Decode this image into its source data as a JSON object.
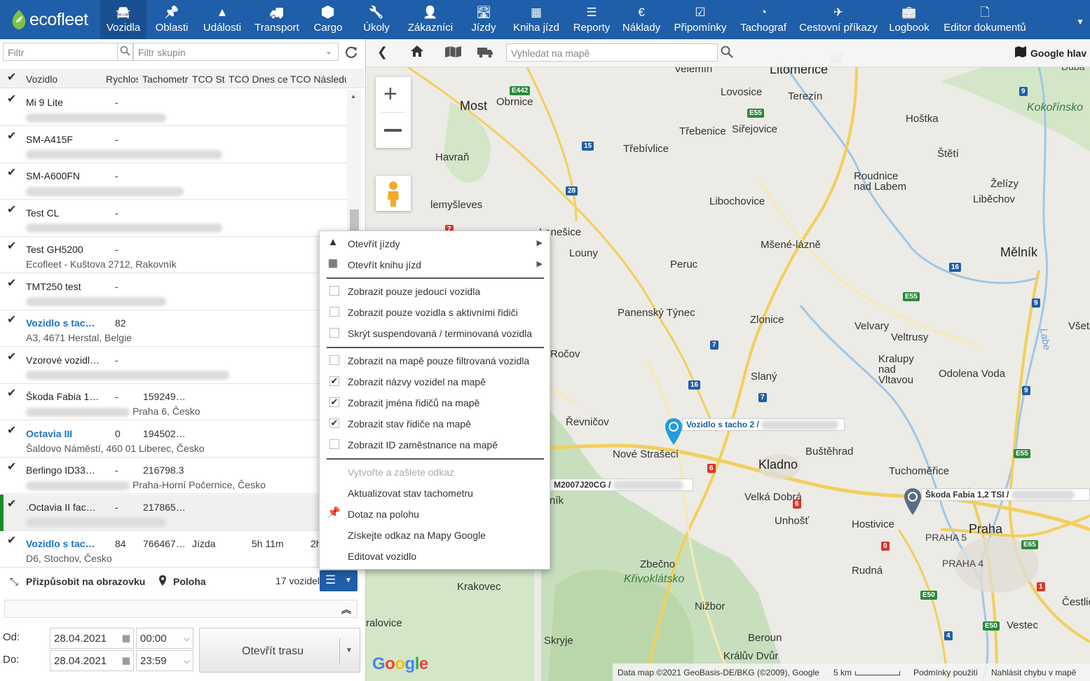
{
  "app": {
    "logo_text": "ecofleet"
  },
  "nav": [
    {
      "label": "Vozidla",
      "icon": "car-icon"
    },
    {
      "label": "Oblasti",
      "icon": "pin-icon"
    },
    {
      "label": "Události",
      "icon": "warning-icon"
    },
    {
      "label": "Transport",
      "icon": "truck-icon"
    },
    {
      "label": "Cargo",
      "icon": "box-icon"
    },
    {
      "label": "Úkoly",
      "icon": "wrench-icon"
    },
    {
      "label": "Zákazníci",
      "icon": "person-icon"
    },
    {
      "label": "Jízdy",
      "icon": "road-icon"
    },
    {
      "label": "Kniha jízd",
      "icon": "calendar-icon"
    },
    {
      "label": "Reporty",
      "icon": "document-icon"
    },
    {
      "label": "Náklady",
      "icon": "euro-icon"
    },
    {
      "label": "Připomínky",
      "icon": "calendar-check-icon"
    },
    {
      "label": "Tachograf",
      "icon": "gauge-icon"
    },
    {
      "label": "Cestovní příkazy",
      "icon": "plane-icon"
    },
    {
      "label": "Logbook",
      "icon": "briefcase-icon"
    },
    {
      "label": "Editor dokumentů",
      "icon": "file-icon"
    }
  ],
  "left": {
    "filter_placeholder": "Filtr",
    "group_filter_placeholder": "Filtr skupin",
    "columns": [
      "Vozidlo",
      "Rychlost",
      "Tachometr",
      "TCO St",
      "TCO Dnes ce",
      "TCO Následu"
    ],
    "vehicles": [
      {
        "name": "Mi 9 Lite",
        "speed": "-",
        "tach": "",
        "status": "",
        "d1": "",
        "d2": "",
        "addr": "",
        "link": false
      },
      {
        "name": "SM-A415F",
        "speed": "-",
        "tach": "",
        "status": "",
        "d1": "",
        "d2": "",
        "addr": "",
        "link": false
      },
      {
        "name": "SM-A600FN",
        "speed": "-",
        "tach": "",
        "status": "",
        "d1": "",
        "d2": "",
        "addr": "",
        "link": false
      },
      {
        "name": "Test CL",
        "speed": "-",
        "tach": "",
        "status": "",
        "d1": "",
        "d2": "",
        "addr": "",
        "link": false
      },
      {
        "name": "Test GH5200",
        "speed": "-",
        "tach": "",
        "status": "",
        "d1": "",
        "d2": "",
        "addr": "Ecofleet - Kuštova 2712, Rakovník",
        "link": false
      },
      {
        "name": "TMT250 test",
        "speed": "-",
        "tach": "",
        "status": "",
        "d1": "",
        "d2": "",
        "addr": "",
        "link": false
      },
      {
        "name": "Vozidlo s tac…",
        "speed": "82",
        "tach": "",
        "status": "",
        "d1": "",
        "d2": "",
        "addr": "A3, 4671 Herstal, Belgie",
        "link": true
      },
      {
        "name": "Vzorové vozidl…",
        "speed": "-",
        "tach": "",
        "status": "",
        "d1": "",
        "d2": "",
        "addr": "",
        "link": false
      },
      {
        "name": "Škoda Fabia 1…",
        "speed": "-",
        "tach": "159249…",
        "status": "",
        "d1": "",
        "d2": "",
        "addr": "Praha 6, Česko",
        "link": false
      },
      {
        "name": "Octavia III",
        "speed": "0",
        "tach": "194502…",
        "status": "",
        "d1": "",
        "d2": "",
        "addr": "Šaldovo Náměstí, 460 01 Liberec, Česko",
        "link": true
      },
      {
        "name": "Berlingo ID33…",
        "speed": "-",
        "tach": "216798.3",
        "status": "",
        "d1": "",
        "d2": "",
        "addr": "Praha-Horní Počernice, Česko",
        "link": false
      },
      {
        "name": ".Octavia II fac…",
        "speed": "-",
        "tach": "217865…",
        "status": "",
        "d1": "",
        "d2": "",
        "addr": "",
        "link": false
      },
      {
        "name": "Vozidlo s tac…",
        "speed": "84",
        "tach": "766467…",
        "status": "Jízda",
        "d1": "5h 11m",
        "d2": "2h",
        "addr": "D6, Stochov, Česko",
        "link": true
      }
    ],
    "fit_label": "Přizpůsobit na obrazovku",
    "position_label": "Poloha",
    "count_label": "17 vozidel",
    "from_label": "Od:",
    "to_label": "Do:",
    "from_date": "28.04.2021",
    "from_time": "00:00",
    "to_date": "28.04.2021",
    "to_time": "23:59",
    "open_route": "Otevřít trasu"
  },
  "map": {
    "search_placeholder": "Vyhledat na mapě",
    "google_label": "Google hlav",
    "attribution": "Data map ©2021 GeoBasis-DE/BKG (©2009), Google",
    "scale": "5 km",
    "terms": "Podmínky použití",
    "report": "Nahlásit chybu v mapě",
    "google_logo": "Google",
    "vehicle_labels": [
      "Vozidlo s tacho 2 /",
      "M2007J20CG /",
      "Škoda Fabia 1,2 TSI /"
    ],
    "places": [
      {
        "t": "Velemín"
      },
      {
        "t": "Litoměřice"
      },
      {
        "t": "Dubá"
      },
      {
        "t": "Lovosice"
      },
      {
        "t": "Terezín"
      },
      {
        "t": "Most"
      },
      {
        "t": "Obrnice"
      },
      {
        "t": "Kokořínsko"
      },
      {
        "t": "Hoštka"
      },
      {
        "t": "Třebenice"
      },
      {
        "t": "Siřejovice"
      },
      {
        "t": "Třebívlice"
      },
      {
        "t": "Štětí"
      },
      {
        "t": "Havraň"
      },
      {
        "t": "Roudnice nad Labem"
      },
      {
        "t": "Želízy"
      },
      {
        "t": "Liběchov"
      },
      {
        "t": "Libochovice"
      },
      {
        "t": "lemyšleves"
      },
      {
        "t": "Lenešice"
      },
      {
        "t": "Mšené-lázně"
      },
      {
        "t": "Louny"
      },
      {
        "t": "Peruc"
      },
      {
        "t": "Mělník"
      },
      {
        "t": "Panenský Týnec"
      },
      {
        "t": "Zlonice"
      },
      {
        "t": "Velvary"
      },
      {
        "t": "Veltrusy"
      },
      {
        "t": "Všetaty"
      },
      {
        "t": "Ročov"
      },
      {
        "t": "Kralupy nad Vltavou"
      },
      {
        "t": "Odolena Voda"
      },
      {
        "t": "Slaný"
      },
      {
        "t": "Řevničov"
      },
      {
        "t": "Nové Strašecí"
      },
      {
        "t": "Buštěhrad"
      },
      {
        "t": "Kladno"
      },
      {
        "t": "Tuchoměřice"
      },
      {
        "t": "Velká Dobrá"
      },
      {
        "t": "Unhošť"
      },
      {
        "t": "Hostivice"
      },
      {
        "t": "Praha"
      },
      {
        "t": "PRAHA 5"
      },
      {
        "t": "PRAHA 4"
      },
      {
        "t": "Rudná"
      },
      {
        "t": "Zbečno"
      },
      {
        "t": "Křivoklátsko"
      },
      {
        "t": "Krakovec"
      },
      {
        "t": "Nižbor"
      },
      {
        "t": "Čestlice"
      },
      {
        "t": "Vestec"
      },
      {
        "t": "ralovice"
      },
      {
        "t": "Skryje"
      },
      {
        "t": "Beroun"
      },
      {
        "t": "Králův Dvůr"
      },
      {
        "t": "Labe"
      },
      {
        "t": "ník"
      }
    ]
  },
  "ctx": {
    "items": [
      {
        "label": "Otevřít jízdy",
        "type": "icon",
        "icon": "road-icon",
        "arrow": true
      },
      {
        "label": "Otevřít knihu jízd",
        "type": "icon",
        "icon": "calendar-icon",
        "arrow": true
      },
      {
        "label": "Zobrazit pouze jedoucí vozidla",
        "type": "check",
        "checked": false
      },
      {
        "label": "Zobrazit pouze vozidla s aktivními řidiči",
        "type": "check",
        "checked": false
      },
      {
        "label": "Skrýt suspendovaná / terminovaná vozidla",
        "type": "check",
        "checked": false
      },
      {
        "label": "Zobrazit na mapě pouze filtrovaná vozidla",
        "type": "check",
        "checked": false
      },
      {
        "label": "Zobrazit názvy vozidel na mapě",
        "type": "check",
        "checked": true
      },
      {
        "label": "Zobrazit jména řidičů na mapě",
        "type": "check",
        "checked": true
      },
      {
        "label": "Zobrazit stav řidiče na mapě",
        "type": "check",
        "checked": true
      },
      {
        "label": "Zobrazit ID zaměstnance na mapě",
        "type": "check",
        "checked": false
      },
      {
        "label": "Vytvořte a zašlete odkaz",
        "type": "plain",
        "disabled": true
      },
      {
        "label": "Aktualizovat stav tachometru",
        "type": "plain"
      },
      {
        "label": "Dotaz na polohu",
        "type": "icon",
        "icon": "pin-icon"
      },
      {
        "label": "Získejte odkaz na Mapy Google",
        "type": "plain"
      },
      {
        "label": "Editovat vozidlo",
        "type": "plain"
      }
    ]
  }
}
